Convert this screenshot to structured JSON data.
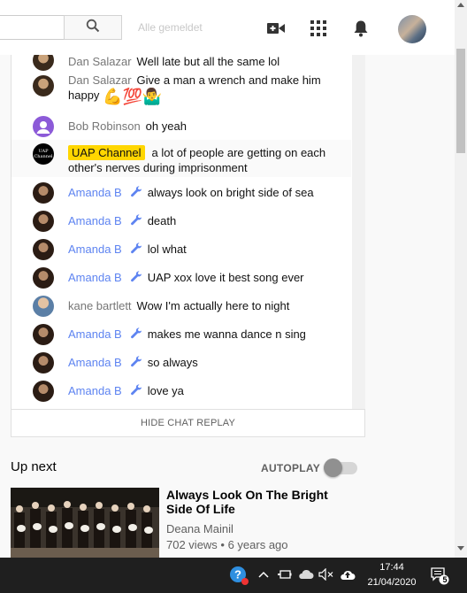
{
  "header": {
    "ghost_text": "Alle gemeldet",
    "search_icon": "search-icon",
    "create_icon": "video-camera-plus-icon",
    "apps_icon": "apps-grid-icon",
    "notifications_icon": "bell-icon"
  },
  "chat": {
    "messages": [
      {
        "author": "Dan Salazar",
        "text": "Well late but all the same lol"
      },
      {
        "author": "Dan Salazar",
        "text": "Give a man a wrench and make him happy",
        "emojis": "💪💯🤷‍♂️"
      },
      {
        "author": "Bob Robinson",
        "text": "oh yeah"
      },
      {
        "author": "UAP Channel",
        "text": "a lot of people are getting on each other's nerves during imprisonment",
        "avatar_text": "UAP Channel"
      },
      {
        "author": "Amanda B",
        "text": "always look on bright side of sea"
      },
      {
        "author": "Amanda B",
        "text": "death"
      },
      {
        "author": "Amanda B",
        "text": "lol what"
      },
      {
        "author": "Amanda B",
        "text": "UAP xox love it best song ever"
      },
      {
        "author": "kane bartlett",
        "text": "Wow I'm actually here to night"
      },
      {
        "author": "Amanda B",
        "text": "makes me wanna dance n sing"
      },
      {
        "author": "Amanda B",
        "text": "so always"
      },
      {
        "author": "Amanda B",
        "text": "love ya"
      }
    ],
    "hide_replay_label": "HIDE CHAT REPLAY",
    "moderator_color": "#5e84f1",
    "highlight_chip_color": "#ffd600"
  },
  "up_next": {
    "heading": "Up next",
    "autoplay_label": "AUTOPLAY",
    "autoplay_on": false,
    "video": {
      "title": "Always Look On The Bright Side Of Life",
      "channel": "Deana Mainil",
      "meta": "702 views • 6 years ago"
    }
  },
  "taskbar": {
    "time": "17:44",
    "date": "21/04/2020",
    "notification_count": "5"
  }
}
